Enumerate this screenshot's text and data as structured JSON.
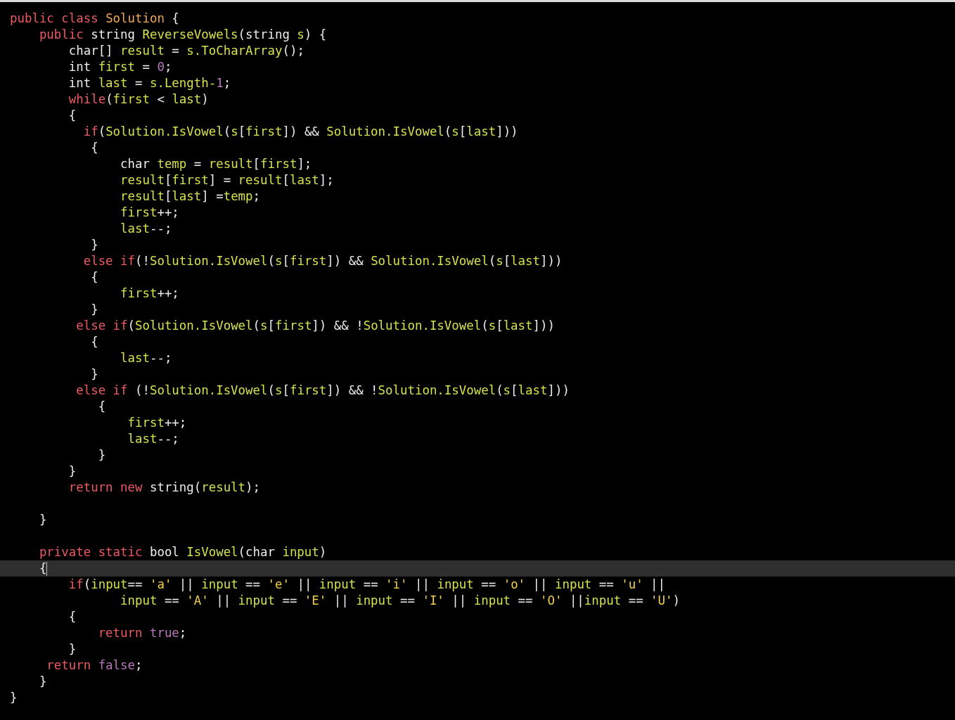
{
  "editor": {
    "lines": [
      {
        "current": false,
        "tokens": [
          {
            "kind": "kw",
            "text": "public class "
          },
          {
            "kind": "cls",
            "text": "Solution"
          },
          {
            "kind": "txt",
            "text": " {"
          }
        ]
      },
      {
        "current": false,
        "tokens": [
          {
            "kind": "kw",
            "text": "    public"
          },
          {
            "kind": "txt",
            "text": " string "
          },
          {
            "kind": "id",
            "text": "ReverseVowels"
          },
          {
            "kind": "txt",
            "text": "(string "
          },
          {
            "kind": "id",
            "text": "s"
          },
          {
            "kind": "txt",
            "text": ") {"
          }
        ]
      },
      {
        "current": false,
        "tokens": [
          {
            "kind": "txt",
            "text": "        char[] "
          },
          {
            "kind": "id",
            "text": "result"
          },
          {
            "kind": "txt",
            "text": " = "
          },
          {
            "kind": "id",
            "text": "s.ToCharArray"
          },
          {
            "kind": "txt",
            "text": "();"
          }
        ]
      },
      {
        "current": false,
        "tokens": [
          {
            "kind": "txt",
            "text": "        int "
          },
          {
            "kind": "id",
            "text": "first"
          },
          {
            "kind": "txt",
            "text": " = "
          },
          {
            "kind": "num",
            "text": "0"
          },
          {
            "kind": "txt",
            "text": ";"
          }
        ]
      },
      {
        "current": false,
        "tokens": [
          {
            "kind": "txt",
            "text": "        int "
          },
          {
            "kind": "id",
            "text": "last"
          },
          {
            "kind": "txt",
            "text": " = "
          },
          {
            "kind": "id",
            "text": "s.Length-"
          },
          {
            "kind": "num",
            "text": "1"
          },
          {
            "kind": "txt",
            "text": ";"
          }
        ]
      },
      {
        "current": false,
        "tokens": [
          {
            "kind": "kw",
            "text": "        while"
          },
          {
            "kind": "txt",
            "text": "("
          },
          {
            "kind": "id",
            "text": "first"
          },
          {
            "kind": "txt",
            "text": " < "
          },
          {
            "kind": "id",
            "text": "last"
          },
          {
            "kind": "txt",
            "text": ")"
          }
        ]
      },
      {
        "current": false,
        "tokens": [
          {
            "kind": "txt",
            "text": "        {"
          }
        ]
      },
      {
        "current": false,
        "tokens": [
          {
            "kind": "kw",
            "text": "          if"
          },
          {
            "kind": "txt",
            "text": "("
          },
          {
            "kind": "id",
            "text": "Solution.IsVowel"
          },
          {
            "kind": "txt",
            "text": "("
          },
          {
            "kind": "id",
            "text": "s"
          },
          {
            "kind": "txt",
            "text": "["
          },
          {
            "kind": "id",
            "text": "first"
          },
          {
            "kind": "txt",
            "text": "]) && "
          },
          {
            "kind": "id",
            "text": "Solution.IsVowel"
          },
          {
            "kind": "txt",
            "text": "("
          },
          {
            "kind": "id",
            "text": "s"
          },
          {
            "kind": "txt",
            "text": "["
          },
          {
            "kind": "id",
            "text": "last"
          },
          {
            "kind": "txt",
            "text": "]))"
          }
        ]
      },
      {
        "current": false,
        "tokens": [
          {
            "kind": "txt",
            "text": "           {"
          }
        ]
      },
      {
        "current": false,
        "tokens": [
          {
            "kind": "txt",
            "text": "               char "
          },
          {
            "kind": "id",
            "text": "temp"
          },
          {
            "kind": "txt",
            "text": " = "
          },
          {
            "kind": "id",
            "text": "result"
          },
          {
            "kind": "txt",
            "text": "["
          },
          {
            "kind": "id",
            "text": "first"
          },
          {
            "kind": "txt",
            "text": "];"
          }
        ]
      },
      {
        "current": false,
        "tokens": [
          {
            "kind": "id",
            "text": "               result"
          },
          {
            "kind": "txt",
            "text": "["
          },
          {
            "kind": "id",
            "text": "first"
          },
          {
            "kind": "txt",
            "text": "] = "
          },
          {
            "kind": "id",
            "text": "result"
          },
          {
            "kind": "txt",
            "text": "["
          },
          {
            "kind": "id",
            "text": "last"
          },
          {
            "kind": "txt",
            "text": "];"
          }
        ]
      },
      {
        "current": false,
        "tokens": [
          {
            "kind": "id",
            "text": "               result"
          },
          {
            "kind": "txt",
            "text": "["
          },
          {
            "kind": "id",
            "text": "last"
          },
          {
            "kind": "txt",
            "text": "] ="
          },
          {
            "kind": "id",
            "text": "temp"
          },
          {
            "kind": "txt",
            "text": ";"
          }
        ]
      },
      {
        "current": false,
        "tokens": [
          {
            "kind": "id",
            "text": "               first"
          },
          {
            "kind": "txt",
            "text": "++;"
          }
        ]
      },
      {
        "current": false,
        "tokens": [
          {
            "kind": "id",
            "text": "               last"
          },
          {
            "kind": "txt",
            "text": "--;"
          }
        ]
      },
      {
        "current": false,
        "tokens": [
          {
            "kind": "txt",
            "text": "           }"
          }
        ]
      },
      {
        "current": false,
        "tokens": [
          {
            "kind": "kw",
            "text": "          else if"
          },
          {
            "kind": "txt",
            "text": "(!"
          },
          {
            "kind": "id",
            "text": "Solution.IsVowel"
          },
          {
            "kind": "txt",
            "text": "("
          },
          {
            "kind": "id",
            "text": "s"
          },
          {
            "kind": "txt",
            "text": "["
          },
          {
            "kind": "id",
            "text": "first"
          },
          {
            "kind": "txt",
            "text": "]) && "
          },
          {
            "kind": "id",
            "text": "Solution.IsVowel"
          },
          {
            "kind": "txt",
            "text": "("
          },
          {
            "kind": "id",
            "text": "s"
          },
          {
            "kind": "txt",
            "text": "["
          },
          {
            "kind": "id",
            "text": "last"
          },
          {
            "kind": "txt",
            "text": "]))"
          }
        ]
      },
      {
        "current": false,
        "tokens": [
          {
            "kind": "txt",
            "text": "           {"
          }
        ]
      },
      {
        "current": false,
        "tokens": [
          {
            "kind": "id",
            "text": "               first"
          },
          {
            "kind": "txt",
            "text": "++;"
          }
        ]
      },
      {
        "current": false,
        "tokens": [
          {
            "kind": "txt",
            "text": "           }"
          }
        ]
      },
      {
        "current": false,
        "tokens": [
          {
            "kind": "kw",
            "text": "         else if"
          },
          {
            "kind": "txt",
            "text": "("
          },
          {
            "kind": "id",
            "text": "Solution.IsVowel"
          },
          {
            "kind": "txt",
            "text": "("
          },
          {
            "kind": "id",
            "text": "s"
          },
          {
            "kind": "txt",
            "text": "["
          },
          {
            "kind": "id",
            "text": "first"
          },
          {
            "kind": "txt",
            "text": "]) && !"
          },
          {
            "kind": "id",
            "text": "Solution.IsVowel"
          },
          {
            "kind": "txt",
            "text": "("
          },
          {
            "kind": "id",
            "text": "s"
          },
          {
            "kind": "txt",
            "text": "["
          },
          {
            "kind": "id",
            "text": "last"
          },
          {
            "kind": "txt",
            "text": "]))"
          }
        ]
      },
      {
        "current": false,
        "tokens": [
          {
            "kind": "txt",
            "text": "           {"
          }
        ]
      },
      {
        "current": false,
        "tokens": [
          {
            "kind": "id",
            "text": "               last"
          },
          {
            "kind": "txt",
            "text": "--;"
          }
        ]
      },
      {
        "current": false,
        "tokens": [
          {
            "kind": "txt",
            "text": "           }"
          }
        ]
      },
      {
        "current": false,
        "tokens": [
          {
            "kind": "kw",
            "text": "         else if "
          },
          {
            "kind": "txt",
            "text": "(!"
          },
          {
            "kind": "id",
            "text": "Solution.IsVowel"
          },
          {
            "kind": "txt",
            "text": "("
          },
          {
            "kind": "id",
            "text": "s"
          },
          {
            "kind": "txt",
            "text": "["
          },
          {
            "kind": "id",
            "text": "first"
          },
          {
            "kind": "txt",
            "text": "]) && !"
          },
          {
            "kind": "id",
            "text": "Solution.IsVowel"
          },
          {
            "kind": "txt",
            "text": "("
          },
          {
            "kind": "id",
            "text": "s"
          },
          {
            "kind": "txt",
            "text": "["
          },
          {
            "kind": "id",
            "text": "last"
          },
          {
            "kind": "txt",
            "text": "]))"
          }
        ]
      },
      {
        "current": false,
        "tokens": [
          {
            "kind": "txt",
            "text": "            {"
          }
        ]
      },
      {
        "current": false,
        "tokens": [
          {
            "kind": "id",
            "text": "                first"
          },
          {
            "kind": "txt",
            "text": "++;"
          }
        ]
      },
      {
        "current": false,
        "tokens": [
          {
            "kind": "id",
            "text": "                last"
          },
          {
            "kind": "txt",
            "text": "--;"
          }
        ]
      },
      {
        "current": false,
        "tokens": [
          {
            "kind": "txt",
            "text": "            }"
          }
        ]
      },
      {
        "current": false,
        "tokens": [
          {
            "kind": "txt",
            "text": "        }"
          }
        ]
      },
      {
        "current": false,
        "tokens": [
          {
            "kind": "kw",
            "text": "        return new "
          },
          {
            "kind": "txt",
            "text": "string("
          },
          {
            "kind": "id",
            "text": "result"
          },
          {
            "kind": "txt",
            "text": ");"
          }
        ]
      },
      {
        "current": false
      },
      {
        "current": false,
        "tokens": [
          {
            "kind": "txt",
            "text": "    }"
          }
        ]
      },
      {
        "current": false
      },
      {
        "current": false,
        "tokens": [
          {
            "kind": "kw",
            "text": "    private static "
          },
          {
            "kind": "txt",
            "text": "bool "
          },
          {
            "kind": "id",
            "text": "IsVowel"
          },
          {
            "kind": "txt",
            "text": "(char "
          },
          {
            "kind": "id",
            "text": "input"
          },
          {
            "kind": "txt",
            "text": ")"
          }
        ]
      },
      {
        "current": true,
        "tokens": [
          {
            "kind": "txt",
            "text": "    {"
          }
        ]
      },
      {
        "current": false,
        "tokens": [
          {
            "kind": "kw",
            "text": "        if"
          },
          {
            "kind": "txt",
            "text": "("
          },
          {
            "kind": "id",
            "text": "input"
          },
          {
            "kind": "txt",
            "text": "== "
          },
          {
            "kind": "chr",
            "text": "'a'"
          },
          {
            "kind": "txt",
            "text": " || "
          },
          {
            "kind": "id",
            "text": "input"
          },
          {
            "kind": "txt",
            "text": " == "
          },
          {
            "kind": "chr",
            "text": "'e'"
          },
          {
            "kind": "txt",
            "text": " || "
          },
          {
            "kind": "id",
            "text": "input"
          },
          {
            "kind": "txt",
            "text": " == "
          },
          {
            "kind": "chr",
            "text": "'i'"
          },
          {
            "kind": "txt",
            "text": " || "
          },
          {
            "kind": "id",
            "text": "input"
          },
          {
            "kind": "txt",
            "text": " == "
          },
          {
            "kind": "chr",
            "text": "'o'"
          },
          {
            "kind": "txt",
            "text": " || "
          },
          {
            "kind": "id",
            "text": "input"
          },
          {
            "kind": "txt",
            "text": " == "
          },
          {
            "kind": "chr",
            "text": "'u'"
          },
          {
            "kind": "txt",
            "text": " ||"
          }
        ]
      },
      {
        "current": false,
        "tokens": [
          {
            "kind": "id",
            "text": "               input"
          },
          {
            "kind": "txt",
            "text": " == "
          },
          {
            "kind": "chr",
            "text": "'A'"
          },
          {
            "kind": "txt",
            "text": " || "
          },
          {
            "kind": "id",
            "text": "input"
          },
          {
            "kind": "txt",
            "text": " == "
          },
          {
            "kind": "chr",
            "text": "'E'"
          },
          {
            "kind": "txt",
            "text": " || "
          },
          {
            "kind": "id",
            "text": "input"
          },
          {
            "kind": "txt",
            "text": " == "
          },
          {
            "kind": "chr",
            "text": "'I'"
          },
          {
            "kind": "txt",
            "text": " || "
          },
          {
            "kind": "id",
            "text": "input"
          },
          {
            "kind": "txt",
            "text": " == "
          },
          {
            "kind": "chr",
            "text": "'O'"
          },
          {
            "kind": "txt",
            "text": " ||"
          },
          {
            "kind": "id",
            "text": "input"
          },
          {
            "kind": "txt",
            "text": " == "
          },
          {
            "kind": "chr",
            "text": "'U'"
          },
          {
            "kind": "txt",
            "text": ")"
          }
        ]
      },
      {
        "current": false,
        "tokens": [
          {
            "kind": "txt",
            "text": "        {"
          }
        ]
      },
      {
        "current": false,
        "tokens": [
          {
            "kind": "kw",
            "text": "            return "
          },
          {
            "kind": "num",
            "text": "true"
          },
          {
            "kind": "txt",
            "text": ";"
          }
        ]
      },
      {
        "current": false,
        "tokens": [
          {
            "kind": "txt",
            "text": "        }"
          }
        ]
      },
      {
        "current": false,
        "tokens": [
          {
            "kind": "kw",
            "text": "     return "
          },
          {
            "kind": "num",
            "text": "false"
          },
          {
            "kind": "txt",
            "text": ";"
          }
        ]
      },
      {
        "current": false,
        "tokens": [
          {
            "kind": "txt",
            "text": "    }"
          }
        ]
      },
      {
        "current": false,
        "tokens": [
          {
            "kind": "txt",
            "text": "}"
          }
        ]
      }
    ]
  }
}
